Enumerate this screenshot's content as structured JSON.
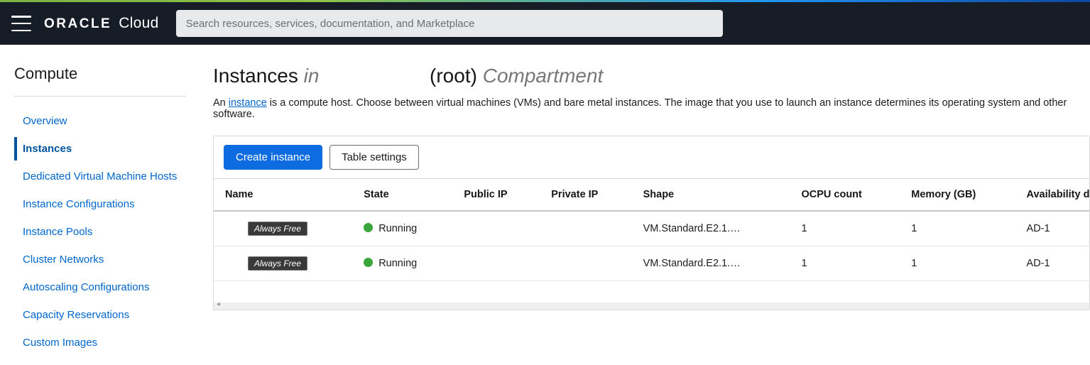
{
  "header": {
    "brand_strong": "ORACLE",
    "brand_light": "Cloud",
    "search_placeholder": "Search resources, services, documentation, and Marketplace"
  },
  "sidebar": {
    "title": "Compute",
    "items": [
      {
        "label": "Overview",
        "active": false
      },
      {
        "label": "Instances",
        "active": true
      },
      {
        "label": "Dedicated Virtual Machine Hosts",
        "active": false
      },
      {
        "label": "Instance Configurations",
        "active": false
      },
      {
        "label": "Instance Pools",
        "active": false
      },
      {
        "label": "Cluster Networks",
        "active": false
      },
      {
        "label": "Autoscaling Configurations",
        "active": false
      },
      {
        "label": "Capacity Reservations",
        "active": false
      },
      {
        "label": "Custom Images",
        "active": false
      }
    ]
  },
  "page": {
    "title_main": "Instances",
    "title_in": "in",
    "title_root": "(root)",
    "title_compartment": "Compartment",
    "desc_prefix": "An ",
    "desc_link": "instance",
    "desc_suffix": " is a compute host. Choose between virtual machines (VMs) and bare metal instances. The image that you use to launch an instance determines its operating system and other software."
  },
  "toolbar": {
    "create_label": "Create instance",
    "settings_label": "Table settings"
  },
  "table": {
    "columns": [
      "Name",
      "State",
      "Public IP",
      "Private IP",
      "Shape",
      "OCPU count",
      "Memory (GB)",
      "Availability domain"
    ],
    "rows": [
      {
        "badge": "Always Free",
        "state": "Running",
        "public_ip": "",
        "private_ip": "",
        "shape": "VM.Standard.E2.1.…",
        "ocpu": "1",
        "memory": "1",
        "ad": "AD-1"
      },
      {
        "badge": "Always Free",
        "state": "Running",
        "public_ip": "",
        "private_ip": "",
        "shape": "VM.Standard.E2.1.…",
        "ocpu": "1",
        "memory": "1",
        "ad": "AD-1"
      }
    ]
  }
}
